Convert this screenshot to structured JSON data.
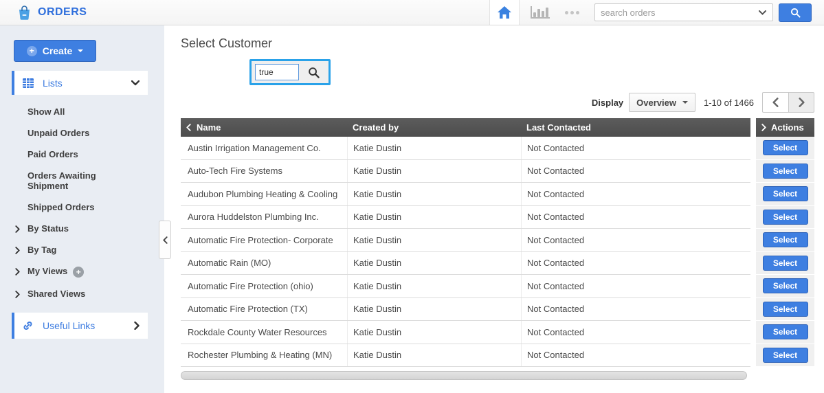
{
  "colors": {
    "accent_blue": "#3e7fe1",
    "brand_text_blue": "#2f6fdc",
    "focus_outline_blue": "#2aa2e9",
    "table_header_bg": "#545454",
    "sidebar_bg": "#e9edf3"
  },
  "topbar": {
    "app_title": "ORDERS",
    "search_placeholder": "search orders"
  },
  "sidebar": {
    "create_label": "Create",
    "lists_label": "Lists",
    "useful_links_label": "Useful Links",
    "items": [
      {
        "label": "Show All",
        "type": "plain"
      },
      {
        "label": "Unpaid Orders",
        "type": "plain"
      },
      {
        "label": "Paid Orders",
        "type": "plain"
      },
      {
        "label": "Orders Awaiting Shipment",
        "type": "plain"
      },
      {
        "label": "Shipped Orders",
        "type": "plain"
      },
      {
        "label": "By Status",
        "type": "expandable"
      },
      {
        "label": "By Tag",
        "type": "expandable"
      },
      {
        "label": "My Views",
        "type": "expandable",
        "has_add_button": true
      },
      {
        "label": "Shared Views",
        "type": "expandable"
      }
    ]
  },
  "main": {
    "page_title": "Select Customer",
    "customer_search": {
      "value": "true"
    },
    "toolbar": {
      "display_label": "Display",
      "display_value": "Overview",
      "range_text": "1-10 of 1466"
    },
    "table": {
      "columns": {
        "name": "Name",
        "created_by": "Created by",
        "last_contacted": "Last Contacted",
        "actions": "Actions"
      },
      "select_label": "Select",
      "rows": [
        {
          "name": "Austin Irrigation Management Co.",
          "created_by": "Katie Dustin",
          "last_contacted": "Not Contacted"
        },
        {
          "name": "Auto-Tech Fire Systems",
          "created_by": "Katie Dustin",
          "last_contacted": "Not Contacted"
        },
        {
          "name": "Audubon Plumbing Heating & Cooling",
          "created_by": "Katie Dustin",
          "last_contacted": "Not Contacted"
        },
        {
          "name": "Aurora Huddelston Plumbing Inc.",
          "created_by": "Katie Dustin",
          "last_contacted": "Not Contacted"
        },
        {
          "name": "Automatic Fire Protection- Corporate",
          "created_by": "Katie Dustin",
          "last_contacted": "Not Contacted"
        },
        {
          "name": "Automatic Rain (MO)",
          "created_by": "Katie Dustin",
          "last_contacted": "Not Contacted"
        },
        {
          "name": "Automatic Fire Protection (ohio)",
          "created_by": "Katie Dustin",
          "last_contacted": "Not Contacted"
        },
        {
          "name": "Automatic Fire Protection (TX)",
          "created_by": "Katie Dustin",
          "last_contacted": "Not Contacted"
        },
        {
          "name": "Rockdale County Water Resources",
          "created_by": "Katie Dustin",
          "last_contacted": "Not Contacted"
        },
        {
          "name": "Rochester Plumbing & Heating (MN)",
          "created_by": "Katie Dustin",
          "last_contacted": "Not Contacted"
        }
      ]
    }
  }
}
